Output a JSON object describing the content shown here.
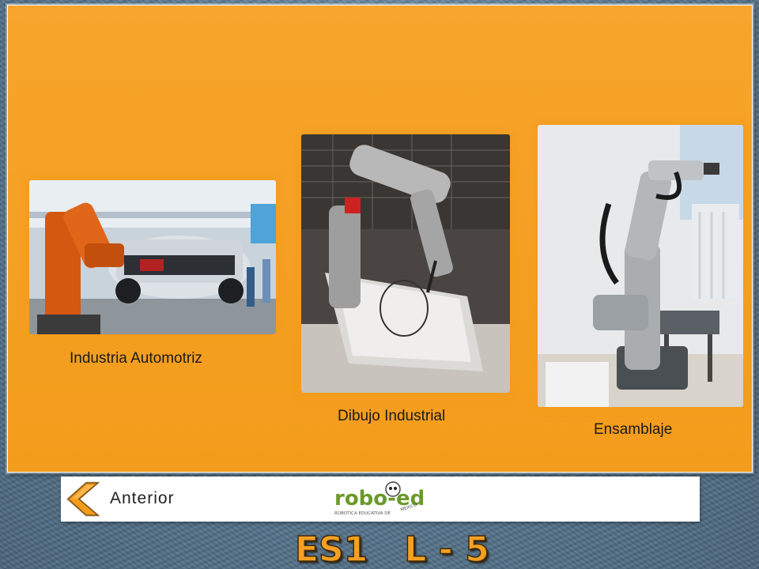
{
  "slide": {
    "images": [
      {
        "caption": "Industria Automotriz",
        "icon": "automotive-robot-photo"
      },
      {
        "caption": "Dibujo Industrial",
        "icon": "drawing-robot-photo"
      },
      {
        "caption": "Ensamblaje",
        "icon": "assembly-robot-photo"
      }
    ]
  },
  "footer": {
    "back_label": "Anterior",
    "logo_text": "robo-ed",
    "logo_subtitle": "ROBOTICA EDUCATIVA DE",
    "logo_country": "MEXICO"
  },
  "title": "ES1   L - 5",
  "colors": {
    "panel_orange": "#f5a023",
    "background": "#5e7d96",
    "arrow_orange": "#f39c1c",
    "logo_green": "#6a9a2a"
  }
}
